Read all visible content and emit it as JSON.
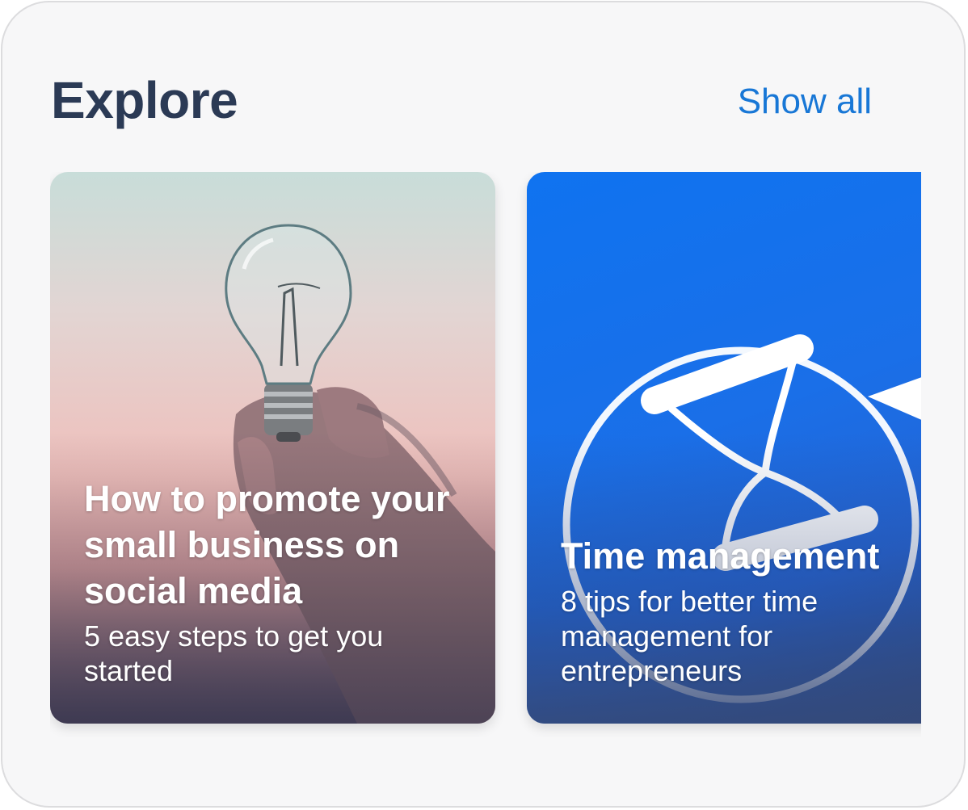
{
  "header": {
    "title": "Explore",
    "show_all_label": "Show all"
  },
  "cards": [
    {
      "title": "How to promote your small business on social media",
      "subtitle": "5 easy steps to get you started",
      "image_icon": "lightbulb-in-hand-icon"
    },
    {
      "title": "Time management",
      "subtitle": "8 tips for better time management for entrepreneurs",
      "image_icon": "hourglass-icon"
    }
  ],
  "colors": {
    "title": "#2b3a55",
    "link": "#1877d6",
    "card2_blue": "#0f73f0"
  }
}
